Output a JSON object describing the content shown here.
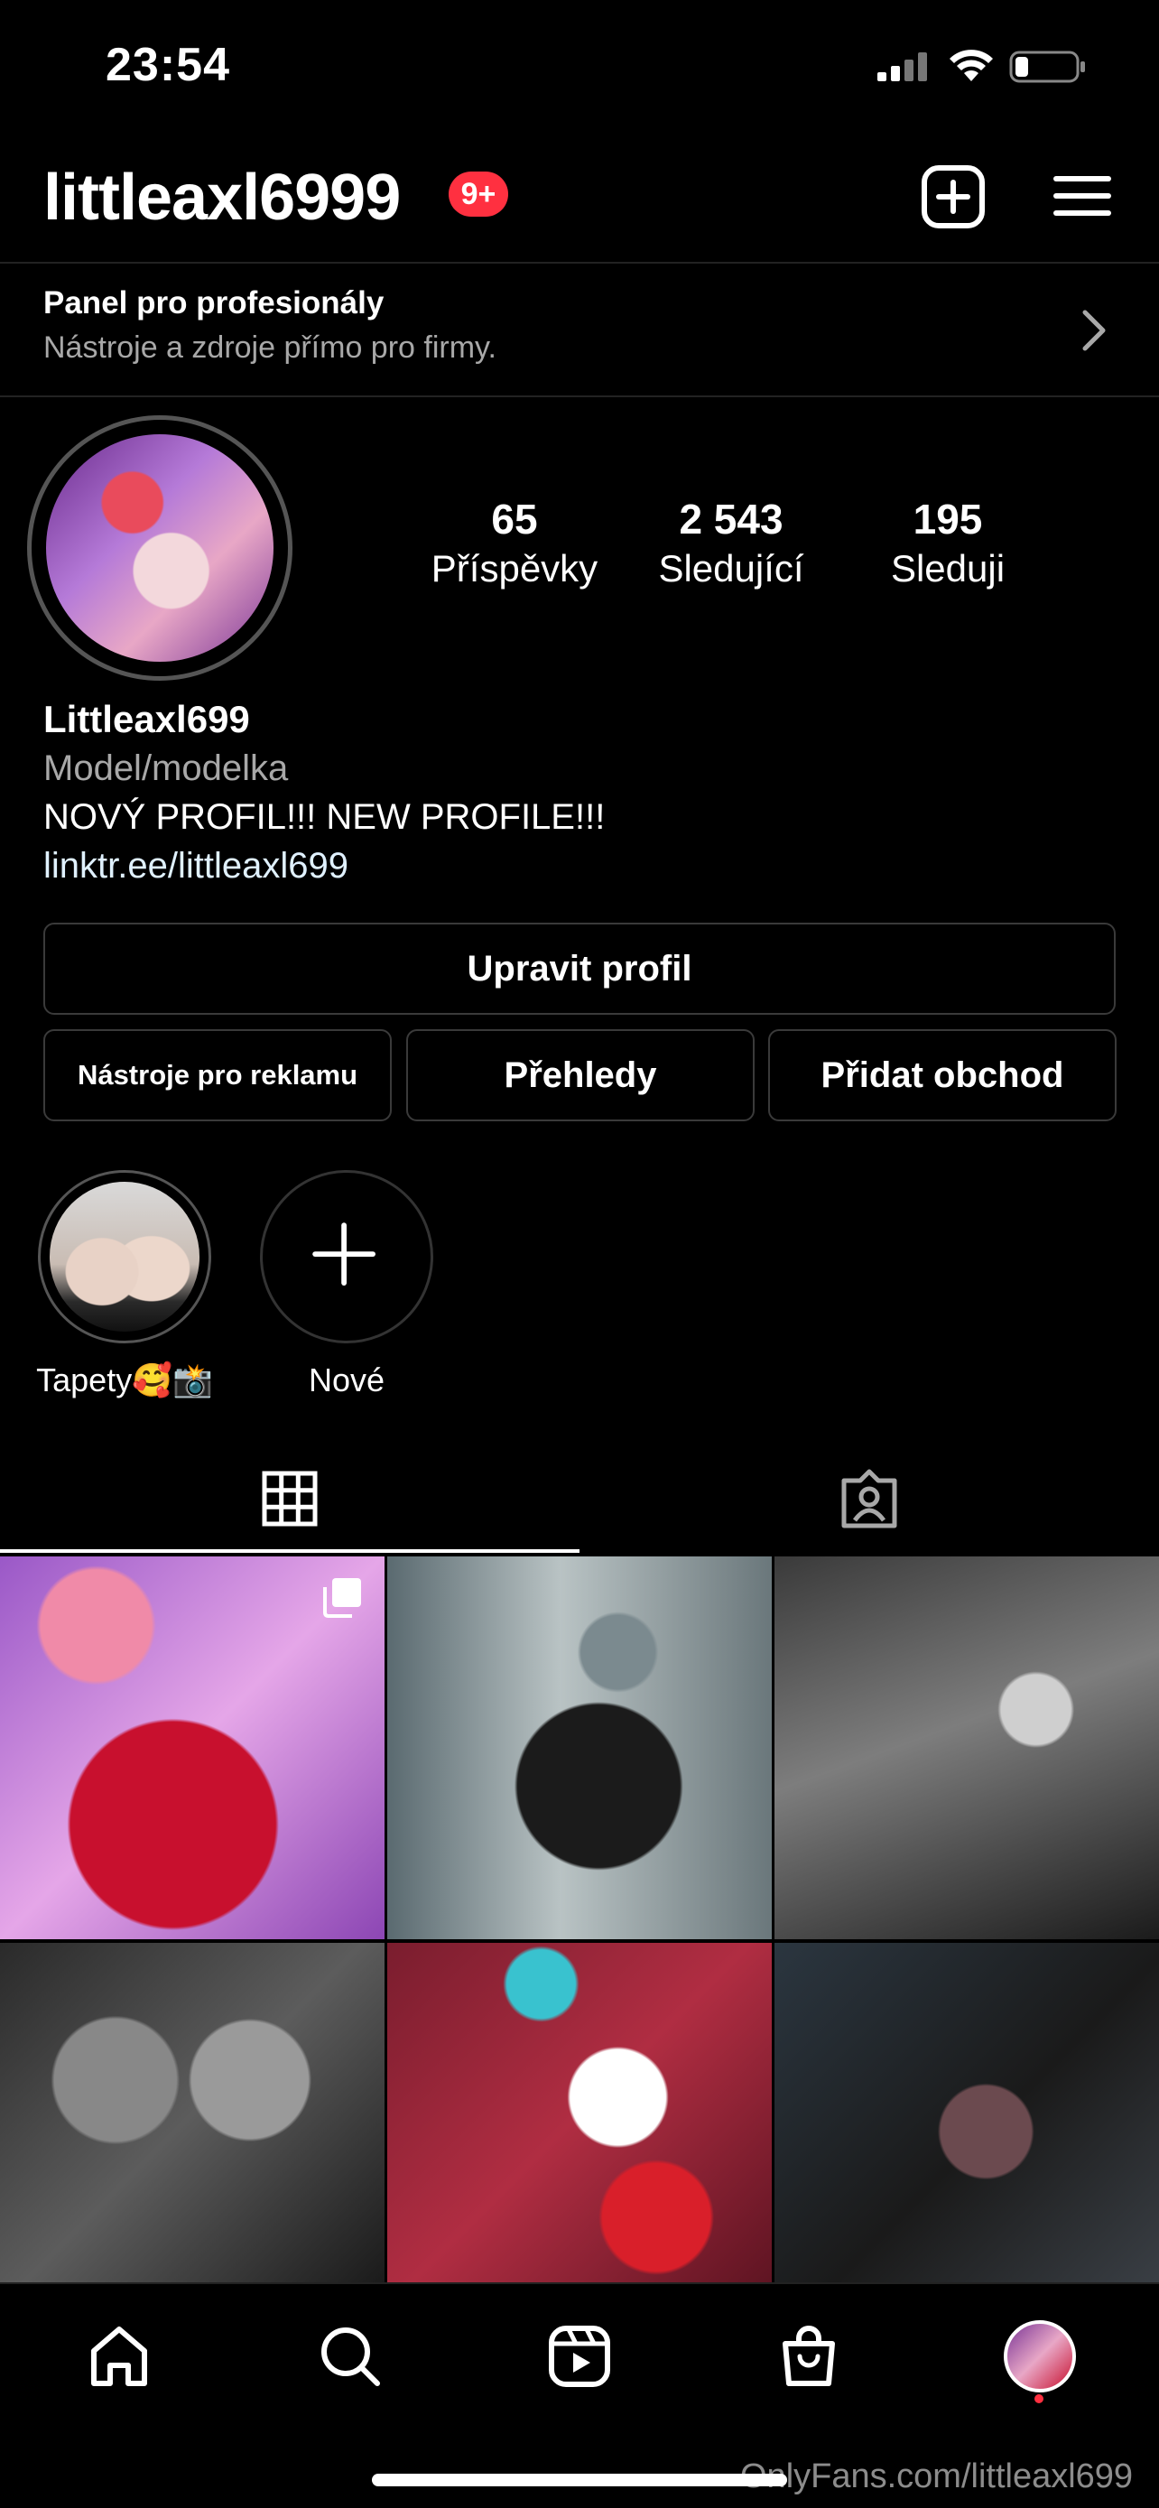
{
  "status_bar": {
    "time": "23:54"
  },
  "header": {
    "username": "littleaxl6999",
    "notification_badge": "9+"
  },
  "pro_panel": {
    "title": "Panel pro profesionály",
    "subtitle": "Nástroje a zdroje přímo pro firmy."
  },
  "stats": [
    {
      "value": "65",
      "label": "Příspěvky"
    },
    {
      "value": "2 543",
      "label": "Sledující"
    },
    {
      "value": "195",
      "label": "Sleduji"
    }
  ],
  "bio": {
    "name": "Littleaxl699",
    "category": "Model/modelka",
    "text": "NOVÝ PROFIL!!! NEW PROFILE!!!",
    "link": "linktr.ee/littleaxl699"
  },
  "buttons": {
    "edit_profile": "Upravit profil",
    "ad_tools": "Nástroje pro reklamu",
    "insights": "Přehledy",
    "add_shop": "Přidat obchod"
  },
  "highlights": [
    {
      "label": "Tapety🥰📸"
    },
    {
      "label": "Nové"
    }
  ],
  "tabs": {
    "active": "grid"
  },
  "posts": {
    "count_visible": 6
  },
  "watermark": "OnlyFans.com/littleaxl699",
  "colors": {
    "background": "#000000",
    "badge": "#ff3040",
    "secondary_text": "#a8a8a8",
    "border": "#3a3a3a"
  },
  "icons": [
    "signal-icon",
    "wifi-icon",
    "battery-icon",
    "plus-square-icon",
    "hamburger-menu-icon",
    "chevron-right-icon",
    "grid-icon",
    "tagged-icon",
    "home-icon",
    "search-icon",
    "reels-icon",
    "shop-icon",
    "multiple-photos-icon"
  ]
}
